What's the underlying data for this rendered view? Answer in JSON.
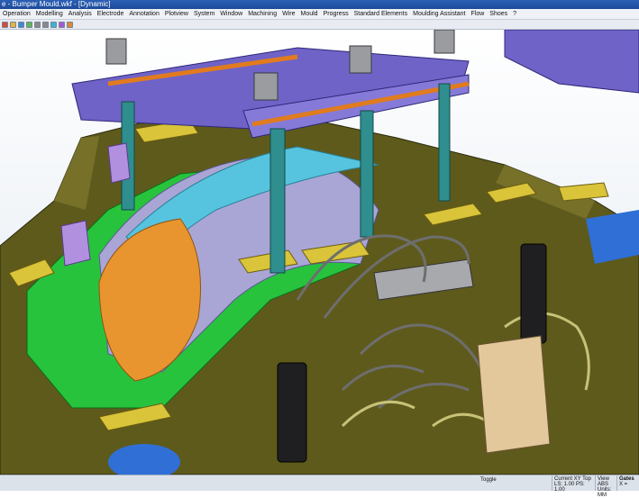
{
  "window": {
    "title": "e - Bumper Mould.wkf - [Dynamic]"
  },
  "menu": [
    "Operation",
    "Modelling",
    "Analysis",
    "Electrode",
    "Annotation",
    "Plotview",
    "System",
    "Window",
    "Machining",
    "Wire",
    "Mould",
    "Progress",
    "Standard Elements",
    "Moulding Assistant",
    "Flow",
    "Shoes",
    "?"
  ],
  "toolbar_icons": [
    "new-icon",
    "open-icon",
    "save-icon",
    "print-icon",
    "undo-icon",
    "redo-icon",
    "zoom-icon",
    "rotate-icon",
    "pan-icon"
  ],
  "status": {
    "toggle": "Toggle",
    "view": "Current XY Top",
    "view_abs": "View ABS",
    "gates": "Gates",
    "ls_ps": "LS: 1.00 PS: 1.00",
    "units": "Units: MM",
    "coord": "X ="
  },
  "colors": {
    "mould_body": "#5e5a1c",
    "plate": "#6f63c8",
    "pillar": "#2f8e8e",
    "bumper": "#e8952f"
  }
}
